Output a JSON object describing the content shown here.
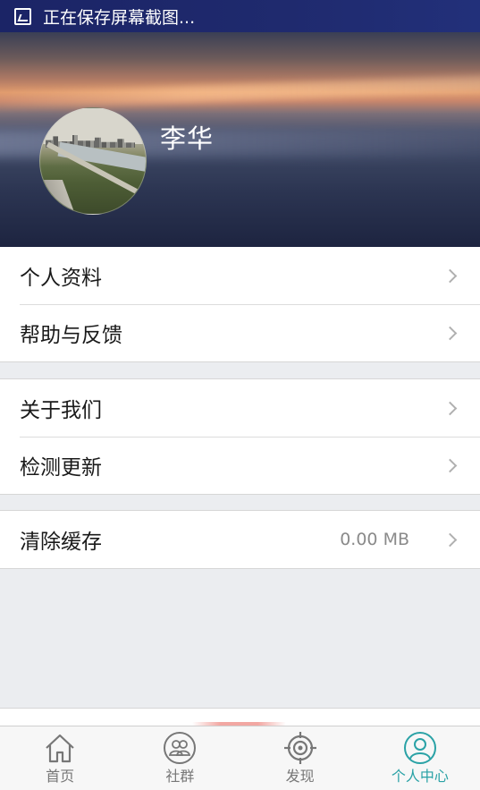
{
  "status_bar": {
    "text": "正在保存屏幕截图..."
  },
  "profile": {
    "name": "李华"
  },
  "menu": {
    "group1": [
      {
        "label": "个人资料"
      },
      {
        "label": "帮助与反馈"
      }
    ],
    "group2": [
      {
        "label": "关于我们"
      },
      {
        "label": "检测更新"
      }
    ],
    "group3": [
      {
        "label": "清除缓存",
        "value": "0.00 MB"
      }
    ]
  },
  "bottom_nav": {
    "items": [
      {
        "label": "首页",
        "icon": "home-icon",
        "active": false
      },
      {
        "label": "社群",
        "icon": "group-icon",
        "active": false
      },
      {
        "label": "发现",
        "icon": "discover-icon",
        "active": false
      },
      {
        "label": "个人中心",
        "icon": "user-icon",
        "active": true
      }
    ],
    "active_color": "#2aa2a6",
    "inactive_color": "#777777"
  }
}
